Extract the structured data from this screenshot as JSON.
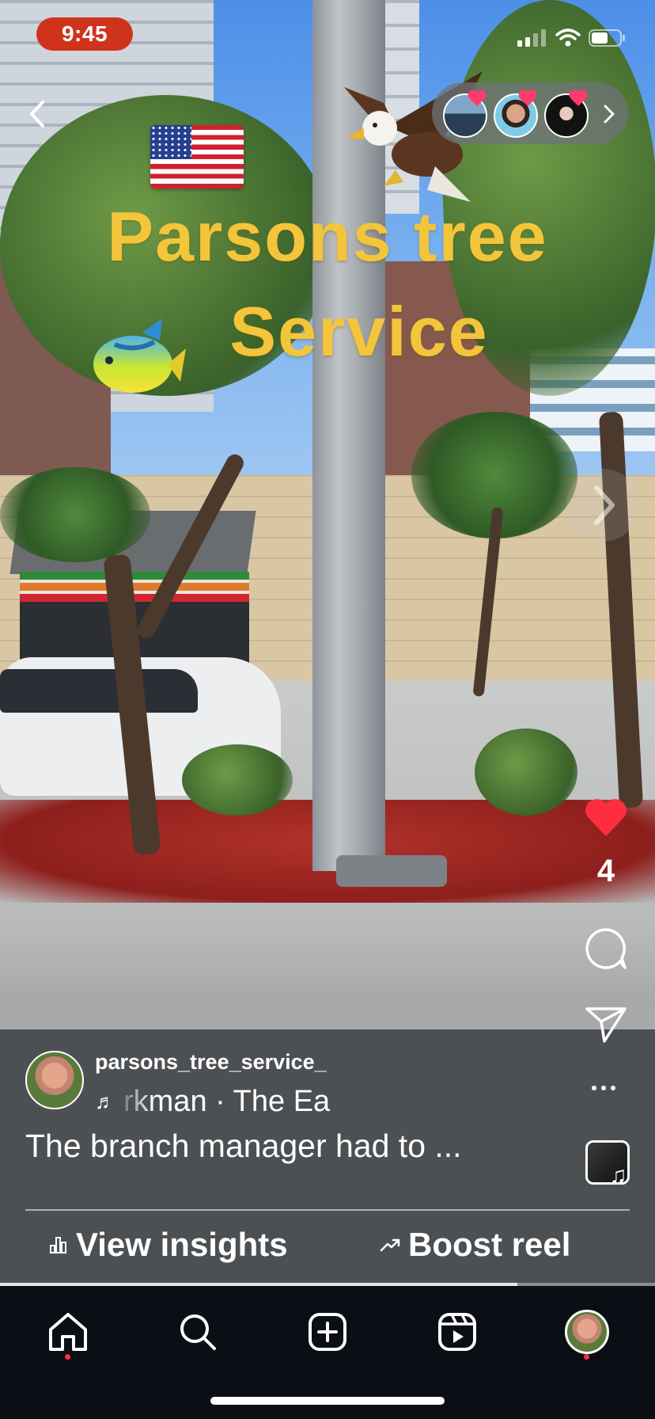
{
  "status_bar": {
    "time": "9:45",
    "icons": [
      "signal-icon",
      "wifi-icon",
      "battery-icon"
    ]
  },
  "overlay": {
    "title_line_1": "Parsons tree",
    "title_line_2": "Service",
    "stickers": [
      "us-flag-sticker",
      "eagle-sticker",
      "tropical-fish-sticker"
    ]
  },
  "viewers": {
    "avatars": [
      "viewer-avatar-1",
      "viewer-avatar-2",
      "viewer-avatar-3"
    ],
    "heart_color": "#ff3b6b"
  },
  "actions": {
    "like_count": "4",
    "like_color": "#ff2d3f"
  },
  "post": {
    "username": "parsons_tree_service_",
    "audio": "rkman · The Ea",
    "caption": "The branch manager had to ..."
  },
  "buttons": {
    "insights_label": "View insights",
    "boost_label": "Boost reel"
  },
  "playback": {
    "progress": 0.79
  },
  "nav": {
    "items": [
      "home-icon",
      "search-icon",
      "create-icon",
      "reels-icon",
      "profile-avatar"
    ],
    "notification_dot_color": "#ff2d4a"
  }
}
